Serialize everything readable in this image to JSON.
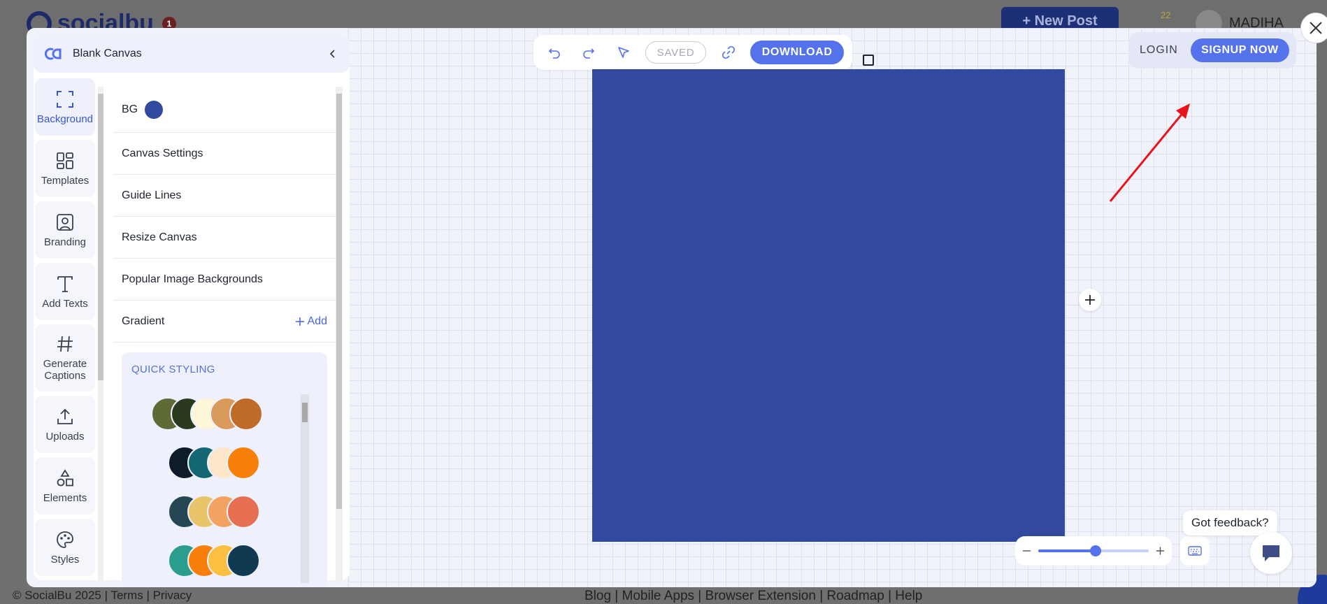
{
  "background_app": {
    "logo_text": "socialbu",
    "logo_badge": "1",
    "new_post_label": "+ New Post",
    "notification_count": "22",
    "user_name": "MADIHA",
    "footer_left": "© SocialBu 2025 | Terms | Privacy",
    "footer_links": "Blog | Mobile Apps | Browser Extension | Roadmap | Help"
  },
  "panel": {
    "title": "Blank Canvas",
    "collapse_icon": "chevron-left-icon"
  },
  "tools": [
    {
      "label": "Background",
      "icon": "frame-icon",
      "active": true
    },
    {
      "label": "Templates",
      "icon": "grid-icon",
      "active": false
    },
    {
      "label": "Branding",
      "icon": "user-square-icon",
      "active": false
    },
    {
      "label": "Add Texts",
      "icon": "text-icon",
      "active": false
    },
    {
      "label": "Generate Captions",
      "icon": "hashtag-icon",
      "active": false
    },
    {
      "label": "Uploads",
      "icon": "upload-icon",
      "active": false
    },
    {
      "label": "Elements",
      "icon": "shapes-icon",
      "active": false
    },
    {
      "label": "Styles",
      "icon": "palette-icon",
      "active": false
    }
  ],
  "settings": {
    "bg_label": "BG",
    "bg_color": "#3249a0",
    "rows": [
      "Canvas Settings",
      "Guide Lines",
      "Resize Canvas",
      "Popular Image Backgrounds"
    ],
    "gradient_label": "Gradient",
    "gradient_add": "Add"
  },
  "quick_styling": {
    "title": "QUICK STYLING",
    "palettes": [
      [
        "#5e6b37",
        "#2b3a1f",
        "#fdf6d8",
        "#d99a5b",
        "#bf6a28"
      ],
      [
        "#0e1c2a",
        "#146673",
        "#fde7cb",
        "#f77f0a"
      ],
      [
        "#264654",
        "#e9c46a",
        "#f4a261",
        "#e76f51"
      ],
      [
        "#2a9d8f",
        "#f77f0a",
        "#fbbf42",
        "#0f3a52"
      ]
    ]
  },
  "toolbar": {
    "saved_label": "SAVED",
    "download_label": "DOWNLOAD"
  },
  "auth": {
    "login_label": "LOGIN",
    "signup_label": "SIGNUP NOW"
  },
  "canvas": {
    "fill_color": "#3249a0"
  },
  "zoom": {
    "level": 0.48
  },
  "feedback": {
    "label": "Got feedback?"
  },
  "colors": {
    "accent": "#5472ec",
    "annotation_arrow": "#e8141b"
  }
}
